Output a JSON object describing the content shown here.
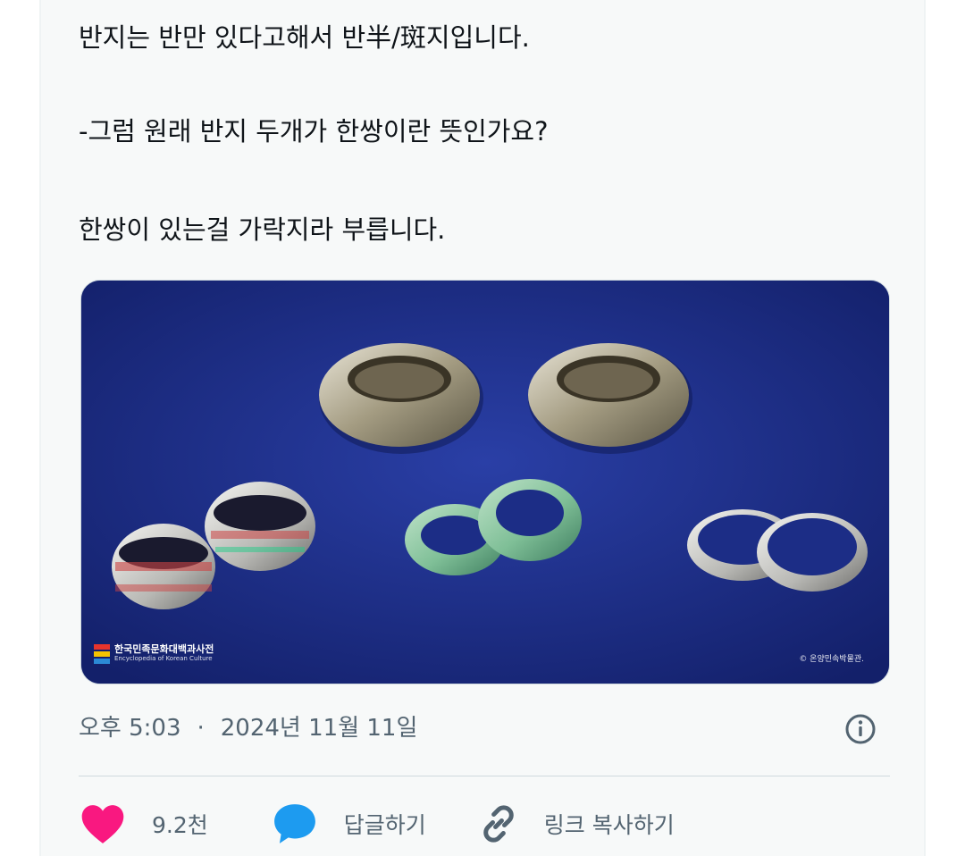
{
  "tweet": {
    "lines": [
      "반지는 반만 있다고해서 반半/斑지입니다.",
      "-그럼 원래 반지 두개가 한쌍이란 뜻인가요?",
      "한쌍이 있는걸 가락지라 부릅니다."
    ]
  },
  "media": {
    "watermark_logo_text": "한국민족문화대백과사전",
    "watermark_logo_subtext": "Encyclopedia of Korean Culture",
    "watermark_credit": "© 온양민속박물관."
  },
  "meta": {
    "time": "오후 5:03",
    "separator": "·",
    "date": "2024년 11월 11일"
  },
  "actions": {
    "like_count": "9.2천",
    "reply_label": "답글하기",
    "copy_link_label": "링크 복사하기"
  },
  "colors": {
    "like": "#f91880",
    "reply": "#1d9bf0",
    "secondary_text": "#536471",
    "photo_background": "#1e2f8a"
  },
  "icons": {
    "like": "heart-icon",
    "reply": "speech-bubble-icon",
    "copy_link": "link-icon",
    "info": "info-icon"
  }
}
